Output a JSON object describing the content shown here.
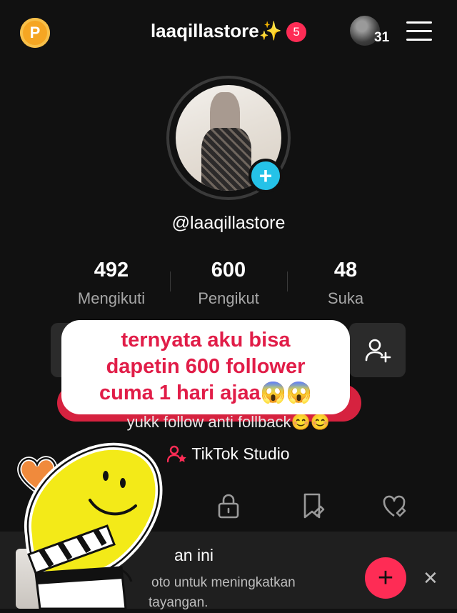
{
  "header": {
    "coin_letter": "P",
    "username": "laaqillastore✨",
    "notification_count": "5",
    "friends_count": "31"
  },
  "profile": {
    "handle": "@laaqillastore",
    "stats": [
      {
        "value": "492",
        "label": "Mengikuti"
      },
      {
        "value": "600",
        "label": "Pengikut"
      },
      {
        "value": "48",
        "label": "Suka"
      }
    ],
    "bio": "yukk follow anti follback😊😊",
    "studio_label": "TikTok Studio"
  },
  "caption_overlay": {
    "line1": "ternyata aku bisa",
    "line2": "dapetin 600 follower",
    "line3": "cuma 1 hari ajaa😱😱"
  },
  "banner": {
    "title": "an ini",
    "subtitle_line1": "oto untuk meningkatkan",
    "subtitle_line2": "tayangan."
  },
  "colors": {
    "accent_red": "#fe2c55",
    "avatar_add": "#25c2e8",
    "caption_text": "#e11d48",
    "sticker_yellow": "#f3ea18"
  }
}
